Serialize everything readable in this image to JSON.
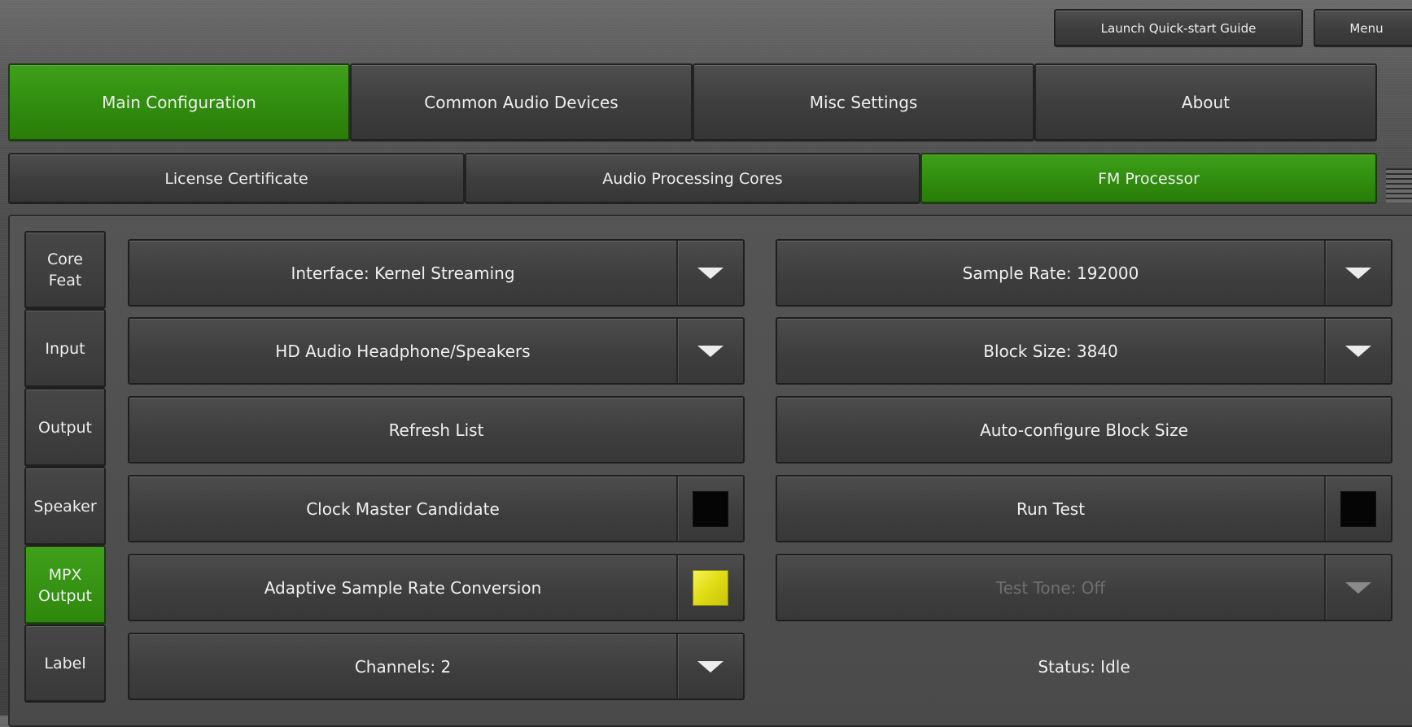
{
  "top_bar": {
    "quick_start_label": "Launch Quick-start Guide",
    "menu_label": "Menu"
  },
  "main_tabs": [
    {
      "label": "Main Configuration",
      "active": true
    },
    {
      "label": "Common Audio Devices",
      "active": false
    },
    {
      "label": "Misc Settings",
      "active": false
    },
    {
      "label": "About",
      "active": false
    }
  ],
  "sub_tabs": [
    {
      "label": "License Certificate",
      "active": false
    },
    {
      "label": "Audio Processing Cores",
      "active": false
    },
    {
      "label": "FM Processor",
      "active": true
    }
  ],
  "sidebar": {
    "items": [
      {
        "label": "Core\nFeat",
        "active": false
      },
      {
        "label": "Input",
        "active": false
      },
      {
        "label": "Output",
        "active": false
      },
      {
        "label": "Speaker",
        "active": false
      },
      {
        "label": "MPX\nOutput",
        "active": true
      },
      {
        "label": "Label",
        "active": false
      }
    ]
  },
  "left_controls": {
    "interface": "Interface: Kernel Streaming",
    "device": "HD Audio Headphone/Speakers",
    "refresh": "Refresh List",
    "clock_master": {
      "label": "Clock Master Candidate",
      "checked": false
    },
    "asrc": {
      "label": "Adaptive Sample Rate Conversion",
      "checked": true
    },
    "channels": "Channels: 2"
  },
  "right_controls": {
    "sample_rate": "Sample Rate: 192000",
    "block_size": "Block Size: 3840",
    "auto_config": "Auto-configure Block Size",
    "run_test": {
      "label": "Run Test",
      "checked": false
    },
    "test_tone": {
      "label": "Test Tone: Off",
      "enabled": false
    },
    "status": "Status: Idle"
  },
  "colors": {
    "active_green": "#2f8a0d",
    "checkbox_on": "#e1dd16",
    "checkbox_off": "#050505"
  }
}
